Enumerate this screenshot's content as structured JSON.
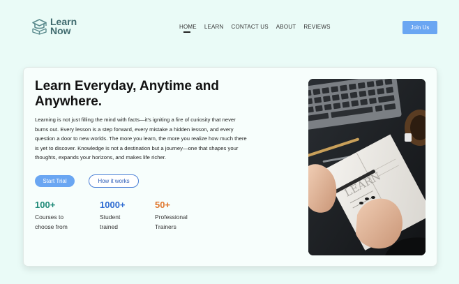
{
  "header": {
    "logo": {
      "line1": "Learn",
      "line2": "Now",
      "icon": "graduation-cap-book-icon"
    },
    "nav": [
      {
        "label": "HOME",
        "active": true
      },
      {
        "label": "LEARN",
        "active": false
      },
      {
        "label": "CONTACT US",
        "active": false
      },
      {
        "label": "ABOUT",
        "active": false
      },
      {
        "label": "REVIEWS",
        "active": false
      }
    ],
    "join_label": "Join Us"
  },
  "hero": {
    "title": "Learn Everyday, Anytime and Anywhere.",
    "description": "Learning is not just filling the mind with facts—it's igniting a fire of curiosity that never burns out. Every lesson is a step forward, every mistake a hidden lesson, and every question a door to new worlds. The more you learn, the more you realize how much there is yet to discover. Knowledge is not a destination but a journey—one that shapes your thoughts, expands your horizons, and makes life richer.",
    "primary_button": "Start Trial",
    "secondary_button": "How it works",
    "stats": [
      {
        "value": "100+",
        "label": "Courses to choose from",
        "color": "#1f8a78"
      },
      {
        "value": "1000+",
        "label": "Student trained",
        "color": "#2c6ad1"
      },
      {
        "value": "50+",
        "label": "Professional Trainers",
        "color": "#e0782f"
      }
    ],
    "image": {
      "subject": "hands-writing-in-notebook-with-keyboard-photo"
    }
  },
  "colors": {
    "background": "#eafbf7",
    "accent": "#6aa6f2",
    "logo": "#3f6a6e"
  }
}
